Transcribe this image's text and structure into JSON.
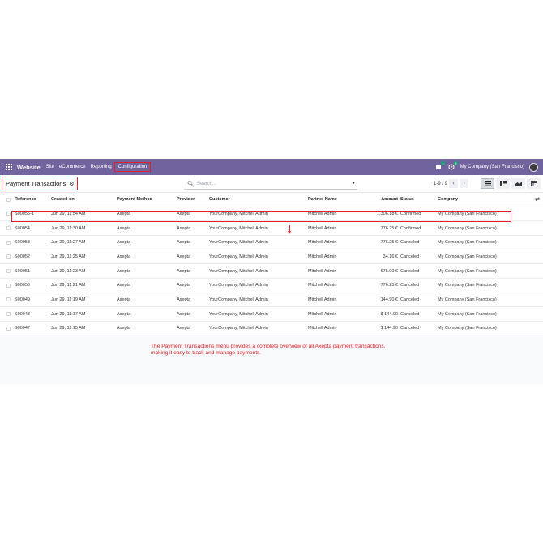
{
  "navbar": {
    "brand": "Website",
    "menu": [
      "Site",
      "eCommerce",
      "Reporting",
      "Configuration"
    ],
    "chat_badge": "1",
    "activity_badge": "4",
    "company": "My Company (San Francisco)"
  },
  "control": {
    "breadcrumb": "Payment Transactions",
    "search_placeholder": "Search...",
    "pager": "1-9 / 9"
  },
  "table": {
    "columns": [
      "Reference",
      "Created on",
      "Payment Method",
      "Provider",
      "Customer",
      "Partner Name",
      "Amount",
      "Status",
      "Company"
    ],
    "rows": [
      [
        "S00055-1",
        "Jun 29, 11:54 AM",
        "Axepta",
        "Axepta",
        "YourCompany, Mitchell Admin",
        "Mitchell Admin",
        "1,306.18 €",
        "Confirmed",
        "My Company (San Francisco)"
      ],
      [
        "S00054",
        "Jun 29, 11:30 AM",
        "Axepta",
        "Axepta",
        "YourCompany, Mitchell Admin",
        "Mitchell Admin",
        "776.25 €",
        "Confirmed",
        "My Company (San Francisco)"
      ],
      [
        "S00053",
        "Jun 29, 11:27 AM",
        "Axepta",
        "Axepta",
        "YourCompany, Mitchell Admin",
        "Mitchell Admin",
        "776.25 €",
        "Canceled",
        "My Company (San Francisco)"
      ],
      [
        "S00052",
        "Jun 29, 11:25 AM",
        "Axepta",
        "Axepta",
        "YourCompany, Mitchell Admin",
        "Mitchell Admin",
        "34.16 €",
        "Canceled",
        "My Company (San Francisco)"
      ],
      [
        "S00051",
        "Jun 29, 11:23 AM",
        "Axepta",
        "Axepta",
        "YourCompany, Mitchell Admin",
        "Mitchell Admin",
        "675.00 €",
        "Canceled",
        "My Company (San Francisco)"
      ],
      [
        "S00050",
        "Jun 29, 11:21 AM",
        "Axepta",
        "Axepta",
        "YourCompany, Mitchell Admin",
        "Mitchell Admin",
        "776.25 €",
        "Canceled",
        "My Company (San Francisco)"
      ],
      [
        "S00049",
        "Jun 29, 11:19 AM",
        "Axepta",
        "Axepta",
        "YourCompany, Mitchell Admin",
        "Mitchell Admin",
        "144.90 €",
        "Canceled",
        "My Company (San Francisco)"
      ],
      [
        "S00048",
        "Jun 29, 11:17 AM",
        "Axepta",
        "Axepta",
        "YourCompany, Mitchell Admin",
        "Mitchell Admin",
        "$ 144.90",
        "Canceled",
        "My Company (San Francisco)"
      ],
      [
        "S00047",
        "Jun 29, 11:15 AM",
        "Axepta",
        "Axepta",
        "YourCompany, Mitchell Admin",
        "Mitchell Admin",
        "$ 144.90",
        "Canceled",
        "My Company (San Francisco)"
      ]
    ]
  },
  "annotation": {
    "line1": "The Payment Transactions menu provides a complete overview of all Axepta payment transactions,",
    "line2": "making it easy to track and manage payments.",
    "color": "#e0202a"
  },
  "colors": {
    "navbar": "#71639e",
    "highlight": "#e0202a"
  }
}
